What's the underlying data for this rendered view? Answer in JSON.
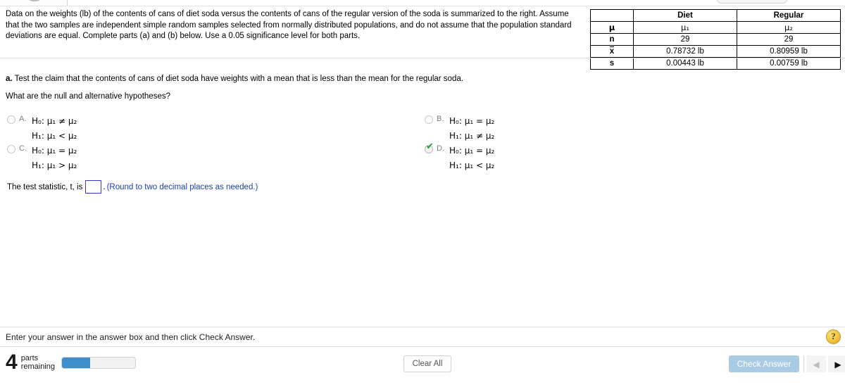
{
  "statement": {
    "text": "Data on the weights (lb) of the contents of cans of diet soda versus the contents of cans of the regular version of the soda is summarized to the right. Assume that the two samples are independent simple random samples selected from normally distributed populations, and do not assume that the population standard deviations are equal. Complete parts (a) and (b) below. Use a 0.05 significance level for both parts."
  },
  "summary_table": {
    "corner_label": "",
    "columns": [
      "Diet",
      "Regular"
    ],
    "rows": [
      {
        "label": "μ",
        "label_type": "mu",
        "diet": "μ₁",
        "regular": "μ₂"
      },
      {
        "label": "n",
        "label_type": "n",
        "diet": "29",
        "regular": "29"
      },
      {
        "label": "x",
        "label_type": "xbar",
        "diet": "0.78732 lb",
        "regular": "0.80959 lb"
      },
      {
        "label": "s",
        "label_type": "s",
        "diet": "0.00443 lb",
        "regular": "0.00759 lb"
      }
    ]
  },
  "part_a": {
    "label": "a.",
    "text": "Test the claim that the contents of cans of diet soda have weights with a mean that is less than the mean for the regular soda.",
    "prompt": "What are the null and alternative hypotheses?"
  },
  "options": [
    {
      "letter": "A.",
      "selected": false,
      "null_hypothesis": "H₀: μ₁ ≠ μ₂",
      "alt_hypothesis": "H₁: μ₁ < μ₂"
    },
    {
      "letter": "B.",
      "selected": false,
      "null_hypothesis": "H₀: μ₁ = μ₂",
      "alt_hypothesis": "H₁: μ₁ ≠ μ₂"
    },
    {
      "letter": "C.",
      "selected": false,
      "null_hypothesis": "H₀: μ₁ = μ₂",
      "alt_hypothesis": "H₁: μ₁ > μ₂"
    },
    {
      "letter": "D.",
      "selected": true,
      "null_hypothesis": "H₀: μ₁ = μ₂",
      "alt_hypothesis": "H₁: μ₁ < μ₂"
    }
  ],
  "test_statistic": {
    "prefix": "The test statistic, t, is",
    "value": "",
    "suffix": ".",
    "note": "(Round to two decimal places as needed.)"
  },
  "footer": {
    "message": "Enter your answer in the answer box and then click Check Answer.",
    "parts_count": "4",
    "parts_label_line1": "parts",
    "parts_label_line2": "remaining",
    "progress_percent": "38",
    "clear_all_label": "Clear All",
    "check_answer_label": "Check Answer",
    "help_icon_label": "?",
    "prev_icon": "◀",
    "next_icon": "▶"
  },
  "colors": {
    "accent_blue": "#3e8ecc",
    "check_answer_bg": "#a9cbe4",
    "answer_box_border": "#3b36c9",
    "note_blue": "#1b3fbd",
    "check_green": "#1a9e2e",
    "help_gold": "#f0c040"
  }
}
